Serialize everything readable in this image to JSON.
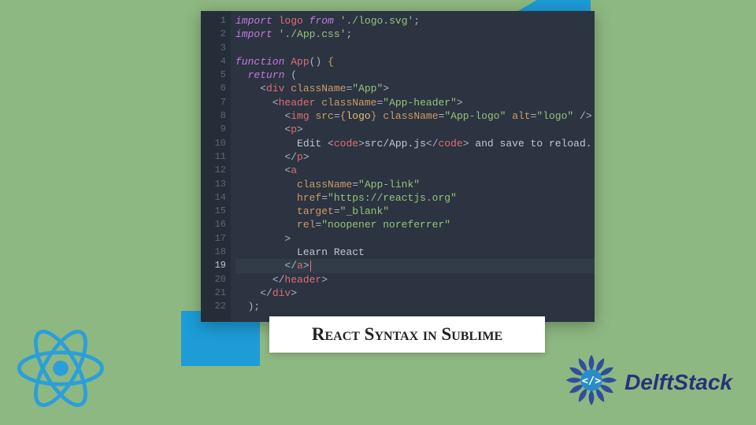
{
  "title": "React Syntax in Sublime",
  "brand": "DelftStack",
  "code_lines": [
    {
      "n": 1,
      "segments": [
        [
          "kw",
          "import"
        ],
        [
          "text",
          " "
        ],
        [
          "def",
          "logo"
        ],
        [
          "text",
          " "
        ],
        [
          "kw",
          "from"
        ],
        [
          "text",
          " "
        ],
        [
          "str",
          "'./logo.svg'"
        ],
        [
          "punct",
          ";"
        ]
      ]
    },
    {
      "n": 2,
      "segments": [
        [
          "kw",
          "import"
        ],
        [
          "text",
          " "
        ],
        [
          "str",
          "'./App.css'"
        ],
        [
          "punct",
          ";"
        ]
      ]
    },
    {
      "n": 3,
      "segments": []
    },
    {
      "n": 4,
      "segments": [
        [
          "kw",
          "function"
        ],
        [
          "text",
          " "
        ],
        [
          "def",
          "App"
        ],
        [
          "punct",
          "()"
        ],
        [
          "text",
          " "
        ],
        [
          "brace",
          "{"
        ]
      ]
    },
    {
      "n": 5,
      "segments": [
        [
          "text",
          "  "
        ],
        [
          "kw",
          "return"
        ],
        [
          "text",
          " "
        ],
        [
          "punct",
          "("
        ]
      ]
    },
    {
      "n": 6,
      "segments": [
        [
          "text",
          "    "
        ],
        [
          "punct",
          "<"
        ],
        [
          "tag",
          "div"
        ],
        [
          "text",
          " "
        ],
        [
          "attr",
          "className"
        ],
        [
          "punct",
          "="
        ],
        [
          "str",
          "\"App\""
        ],
        [
          "punct",
          ">"
        ]
      ]
    },
    {
      "n": 7,
      "segments": [
        [
          "text",
          "      "
        ],
        [
          "punct",
          "<"
        ],
        [
          "tag",
          "header"
        ],
        [
          "text",
          " "
        ],
        [
          "attr",
          "className"
        ],
        [
          "punct",
          "="
        ],
        [
          "str",
          "\"App-header\""
        ],
        [
          "punct",
          ">"
        ]
      ]
    },
    {
      "n": 8,
      "segments": [
        [
          "text",
          "        "
        ],
        [
          "punct",
          "<"
        ],
        [
          "tag",
          "img"
        ],
        [
          "text",
          " "
        ],
        [
          "attr",
          "src"
        ],
        [
          "punct",
          "="
        ],
        [
          "brace",
          "{"
        ],
        [
          "val",
          "logo"
        ],
        [
          "brace",
          "}"
        ],
        [
          "text",
          " "
        ],
        [
          "attr",
          "className"
        ],
        [
          "punct",
          "="
        ],
        [
          "str",
          "\"App-logo\""
        ],
        [
          "text",
          " "
        ],
        [
          "attr",
          "alt"
        ],
        [
          "punct",
          "="
        ],
        [
          "str",
          "\"logo\""
        ],
        [
          "text",
          " "
        ],
        [
          "punct",
          "/>"
        ]
      ]
    },
    {
      "n": 9,
      "segments": [
        [
          "text",
          "        "
        ],
        [
          "punct",
          "<"
        ],
        [
          "tag",
          "p"
        ],
        [
          "punct",
          ">"
        ]
      ]
    },
    {
      "n": 10,
      "segments": [
        [
          "text",
          "          "
        ],
        [
          "text",
          "Edit "
        ],
        [
          "punct",
          "<"
        ],
        [
          "tag",
          "code"
        ],
        [
          "punct",
          ">"
        ],
        [
          "text",
          "src/App.js"
        ],
        [
          "punct",
          "</"
        ],
        [
          "tag",
          "code"
        ],
        [
          "punct",
          ">"
        ],
        [
          "text",
          " and save to reload."
        ]
      ]
    },
    {
      "n": 11,
      "segments": [
        [
          "text",
          "        "
        ],
        [
          "punct",
          "</"
        ],
        [
          "tag",
          "p"
        ],
        [
          "punct",
          ">"
        ]
      ]
    },
    {
      "n": 12,
      "segments": [
        [
          "text",
          "        "
        ],
        [
          "punct",
          "<"
        ],
        [
          "tag",
          "a"
        ]
      ]
    },
    {
      "n": 13,
      "segments": [
        [
          "text",
          "          "
        ],
        [
          "attr",
          "className"
        ],
        [
          "punct",
          "="
        ],
        [
          "str",
          "\"App-link\""
        ]
      ]
    },
    {
      "n": 14,
      "segments": [
        [
          "text",
          "          "
        ],
        [
          "attr",
          "href"
        ],
        [
          "punct",
          "="
        ],
        [
          "str",
          "\"https://reactjs.org\""
        ]
      ]
    },
    {
      "n": 15,
      "segments": [
        [
          "text",
          "          "
        ],
        [
          "attr",
          "target"
        ],
        [
          "punct",
          "="
        ],
        [
          "str",
          "\"_blank\""
        ]
      ]
    },
    {
      "n": 16,
      "segments": [
        [
          "text",
          "          "
        ],
        [
          "attr",
          "rel"
        ],
        [
          "punct",
          "="
        ],
        [
          "str",
          "\"noopener noreferrer\""
        ]
      ]
    },
    {
      "n": 17,
      "segments": [
        [
          "text",
          "        "
        ],
        [
          "punct",
          ">"
        ]
      ]
    },
    {
      "n": 18,
      "segments": [
        [
          "text",
          "          "
        ],
        [
          "text",
          "Learn React"
        ]
      ]
    },
    {
      "n": 19,
      "active": true,
      "cursor": true,
      "segments": [
        [
          "text",
          "        "
        ],
        [
          "punct",
          "</"
        ],
        [
          "tag",
          "a"
        ],
        [
          "punct",
          ">"
        ]
      ]
    },
    {
      "n": 20,
      "segments": [
        [
          "text",
          "      "
        ],
        [
          "punct",
          "</"
        ],
        [
          "tag",
          "header"
        ],
        [
          "punct",
          ">"
        ]
      ]
    },
    {
      "n": 21,
      "segments": [
        [
          "text",
          "    "
        ],
        [
          "punct",
          "</"
        ],
        [
          "tag",
          "div"
        ],
        [
          "punct",
          ">"
        ]
      ]
    },
    {
      "n": 22,
      "segments": [
        [
          "text",
          "  "
        ],
        [
          "punct",
          ")"
        ],
        [
          "punct",
          ";"
        ]
      ]
    }
  ]
}
